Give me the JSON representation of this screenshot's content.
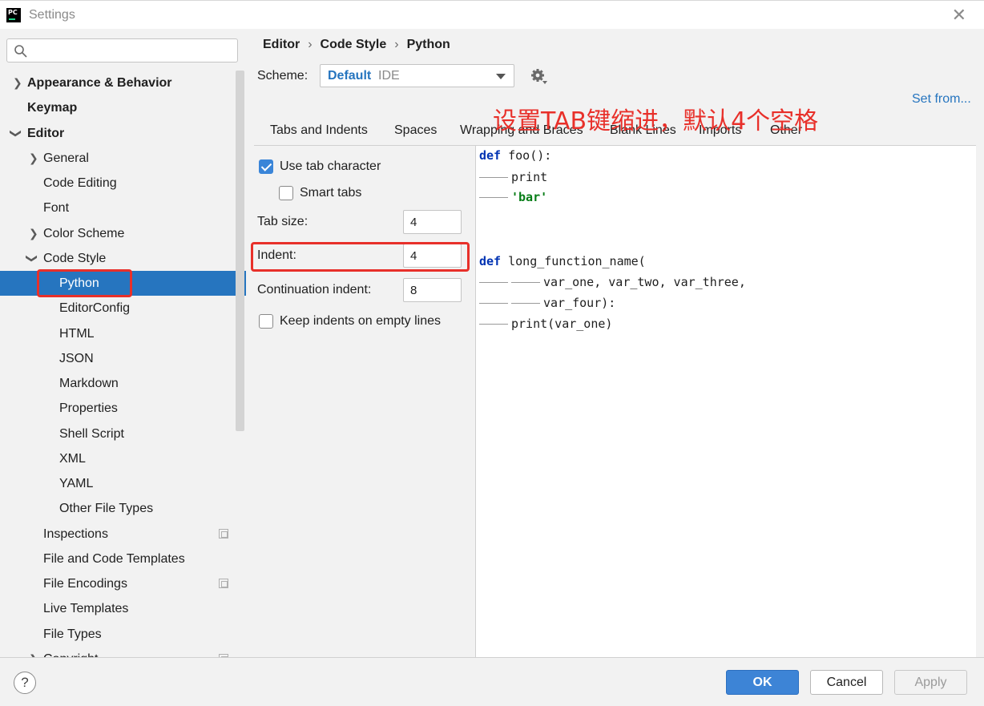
{
  "window": {
    "title": "Settings",
    "app_icon_text": "PC"
  },
  "search": {
    "placeholder": ""
  },
  "sidebar": {
    "items": [
      {
        "label": "Appearance & Behavior"
      },
      {
        "label": "Keymap"
      },
      {
        "label": "Editor"
      },
      {
        "label": "General"
      },
      {
        "label": "Code Editing"
      },
      {
        "label": "Font"
      },
      {
        "label": "Color Scheme"
      },
      {
        "label": "Code Style"
      },
      {
        "label": "Python"
      },
      {
        "label": "EditorConfig"
      },
      {
        "label": "HTML"
      },
      {
        "label": "JSON"
      },
      {
        "label": "Markdown"
      },
      {
        "label": "Properties"
      },
      {
        "label": "Shell Script"
      },
      {
        "label": "XML"
      },
      {
        "label": "YAML"
      },
      {
        "label": "Other File Types"
      },
      {
        "label": "Inspections"
      },
      {
        "label": "File and Code Templates"
      },
      {
        "label": "File Encodings"
      },
      {
        "label": "Live Templates"
      },
      {
        "label": "File Types"
      },
      {
        "label": "Copyright"
      }
    ],
    "selected": "Python"
  },
  "breadcrumb": {
    "items": [
      "Editor",
      "Code Style",
      "Python"
    ]
  },
  "scheme": {
    "label": "Scheme:",
    "value": "Default",
    "sub": "IDE"
  },
  "set_from": "Set from...",
  "tabs": [
    "Tabs and Indents",
    "Spaces",
    "Wrapping and Braces",
    "Blank Lines",
    "Imports",
    "Other"
  ],
  "active_tab": "Tabs and Indents",
  "options": {
    "use_tab_label": "Use tab character",
    "use_tab_checked": true,
    "smart_tabs_label": "Smart tabs",
    "smart_tabs_checked": false,
    "tab_size_label": "Tab size:",
    "tab_size_value": "4",
    "indent_label": "Indent:",
    "indent_value": "4",
    "continuation_label": "Continuation indent:",
    "continuation_value": "8",
    "keep_indents_label": "Keep indents on empty lines",
    "keep_indents_checked": false
  },
  "preview": {
    "l1_kw": "def",
    "l1_rest": " foo():",
    "l2": "print",
    "l3": "'bar'",
    "l4_kw": "def",
    "l4_rest": " long_function_name(",
    "l5": "var_one, var_two, var_three,",
    "l6": "var_four):",
    "l7": "print(var_one)"
  },
  "annotation": "设置TAB键缩进，默认4个空格",
  "buttons": {
    "help": "?",
    "ok": "OK",
    "cancel": "Cancel",
    "apply": "Apply"
  },
  "colors": {
    "accent": "#2675bf",
    "annotation": "#e8302a",
    "keyword": "#0033b3",
    "string": "#067d17"
  }
}
